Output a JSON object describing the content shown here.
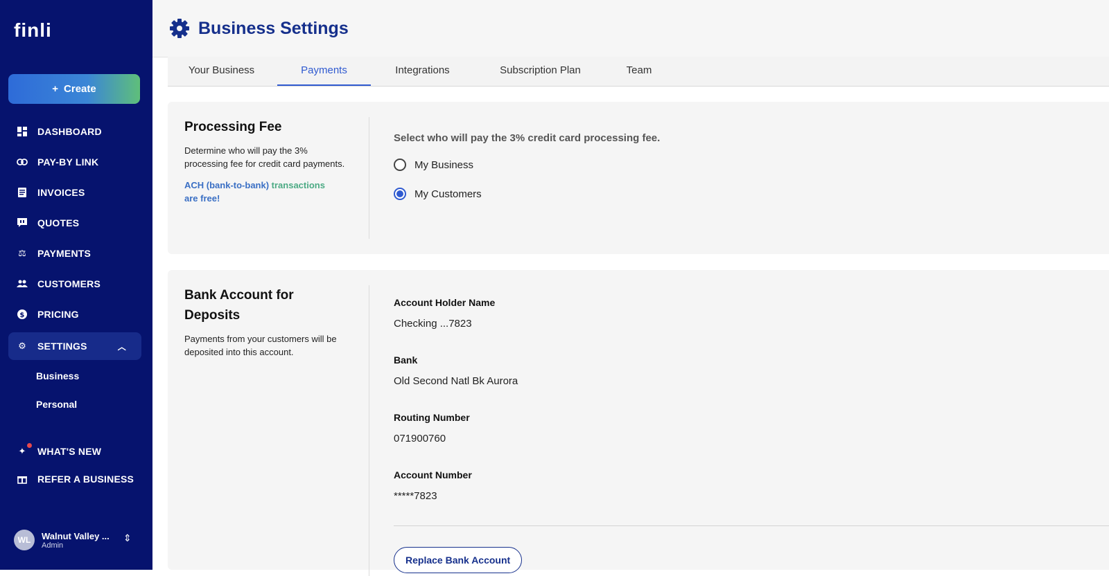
{
  "sidebar": {
    "logo": "finli",
    "create_label": "Create",
    "create_icon": "+",
    "items": [
      {
        "label": "DASHBOARD",
        "icon": "dashboard-icon"
      },
      {
        "label": "PAY-BY LINK",
        "icon": "link-icon"
      },
      {
        "label": "INVOICES",
        "icon": "invoice-icon"
      },
      {
        "label": "QUOTES",
        "icon": "quote-icon"
      },
      {
        "label": "PAYMENTS",
        "icon": "scale-icon"
      },
      {
        "label": "CUSTOMERS",
        "icon": "people-icon"
      },
      {
        "label": "PRICING",
        "icon": "dollar-icon"
      },
      {
        "label": "SETTINGS",
        "icon": "gear-icon"
      }
    ],
    "settings_sub": [
      "Business",
      "Personal"
    ],
    "whats_new": "WHAT'S NEW",
    "refer": "REFER A BUSINESS",
    "user": {
      "initials": "WL",
      "name": "Walnut Valley ...",
      "role": "Admin"
    }
  },
  "header": {
    "title": "Business Settings",
    "icon": "gear-icon"
  },
  "tabs": [
    "Your Business",
    "Payments",
    "Integrations",
    "Subscription Plan",
    "Team"
  ],
  "active_tab": "Payments",
  "processing_fee": {
    "title": "Processing Fee",
    "description": "Determine who will pay the 3% processing fee for credit card payments.",
    "note_blue": "ACH (bank-to-bank)",
    "note_green": " transactions",
    "note_end": "are free!",
    "prompt": "Select who will pay the 3% credit card processing fee.",
    "options": [
      "My Business",
      "My Customers"
    ],
    "selected": "My Customers"
  },
  "bank": {
    "title": "Bank Account for Deposits",
    "description": "Payments from your customers will be deposited into this account.",
    "fields": [
      {
        "label": "Account Holder Name",
        "value": "Checking ...7823"
      },
      {
        "label": "Bank",
        "value": "Old Second Natl Bk Aurora"
      },
      {
        "label": "Routing Number",
        "value": "071900760"
      },
      {
        "label": "Account Number",
        "value": "*****7823"
      }
    ],
    "replace_label": "Replace Bank Account"
  },
  "colors": {
    "sidebar": "#06136e",
    "accent": "#2f5ad0",
    "title": "#16308c"
  }
}
